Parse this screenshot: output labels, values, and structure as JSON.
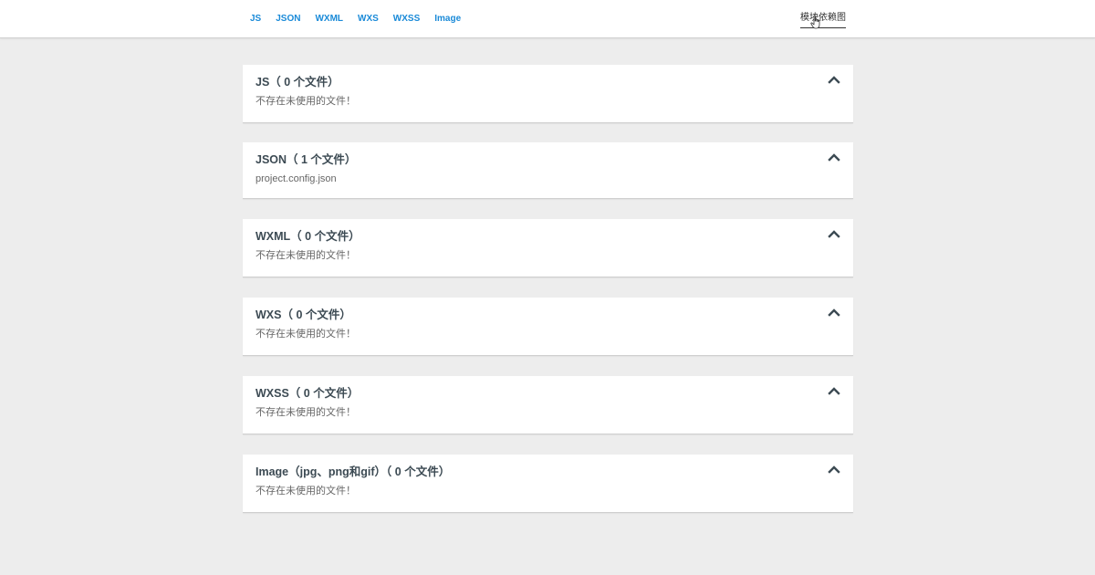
{
  "nav": {
    "tabs": [
      {
        "label": "JS"
      },
      {
        "label": "JSON"
      },
      {
        "label": "WXML"
      },
      {
        "label": "WXS"
      },
      {
        "label": "WXSS"
      },
      {
        "label": "Image"
      }
    ],
    "deps_link": "模块依赖图"
  },
  "panels": [
    {
      "title": "JS（ 0 个文件）",
      "body": "不存在未使用的文件！"
    },
    {
      "title": "JSON（ 1 个文件）",
      "body": "project.config.json"
    },
    {
      "title": "WXML（ 0 个文件）",
      "body": "不存在未使用的文件！"
    },
    {
      "title": "WXS（ 0 个文件）",
      "body": "不存在未使用的文件！"
    },
    {
      "title": "WXSS（ 0 个文件）",
      "body": "不存在未使用的文件！"
    },
    {
      "title": "Image（jpg、png和gif）（ 0 个文件）",
      "body": "不存在未使用的文件！"
    }
  ],
  "icons": {
    "collapse": "chevron-up-icon",
    "cursor": "hand-pointer-icon"
  },
  "colors": {
    "tab": "#1a8ad8",
    "title": "#3c4a53",
    "background": "#ededed"
  }
}
